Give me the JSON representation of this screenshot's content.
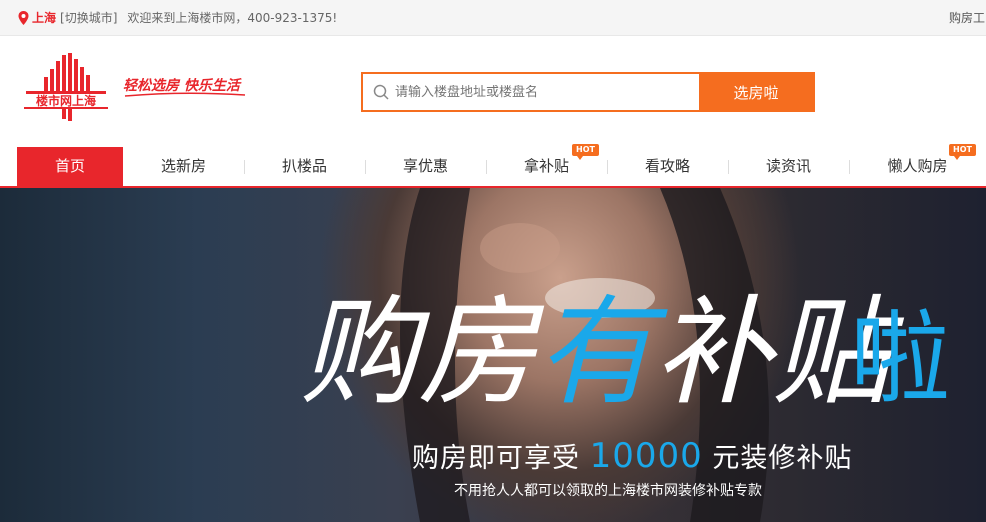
{
  "topbar": {
    "city": "上海",
    "switch_city": "[切换城市]",
    "welcome": "欢迎来到上海楼市网，400-923-1375!",
    "right_link": "购房工"
  },
  "logo": {
    "text": "楼市网上海"
  },
  "slogan": "轻松选房 快乐生活",
  "search": {
    "placeholder": "请输入楼盘地址或楼盘名",
    "button": "选房啦"
  },
  "nav": {
    "items": [
      {
        "label": "首页",
        "hot": ""
      },
      {
        "label": "选新房",
        "hot": ""
      },
      {
        "label": "扒楼品",
        "hot": ""
      },
      {
        "label": "享优惠",
        "hot": ""
      },
      {
        "label": "拿补贴",
        "hot": "HOT"
      },
      {
        "label": "看攻略",
        "hot": ""
      },
      {
        "label": "读资讯",
        "hot": ""
      },
      {
        "label": "懒人购房",
        "hot": "HOT"
      }
    ]
  },
  "banner": {
    "headline_parts": [
      "购房",
      "有",
      "补贴",
      "啦"
    ],
    "sub_prefix": "购房即可享受",
    "amount": "10000",
    "sub_suffix": "元装修补贴",
    "note": "不用抢人人都可以领取的上海楼市网装修补贴专款"
  },
  "colors": {
    "brand_red": "#e8262c",
    "accent_orange": "#f56d1f",
    "banner_blue": "#1aa8ea"
  }
}
